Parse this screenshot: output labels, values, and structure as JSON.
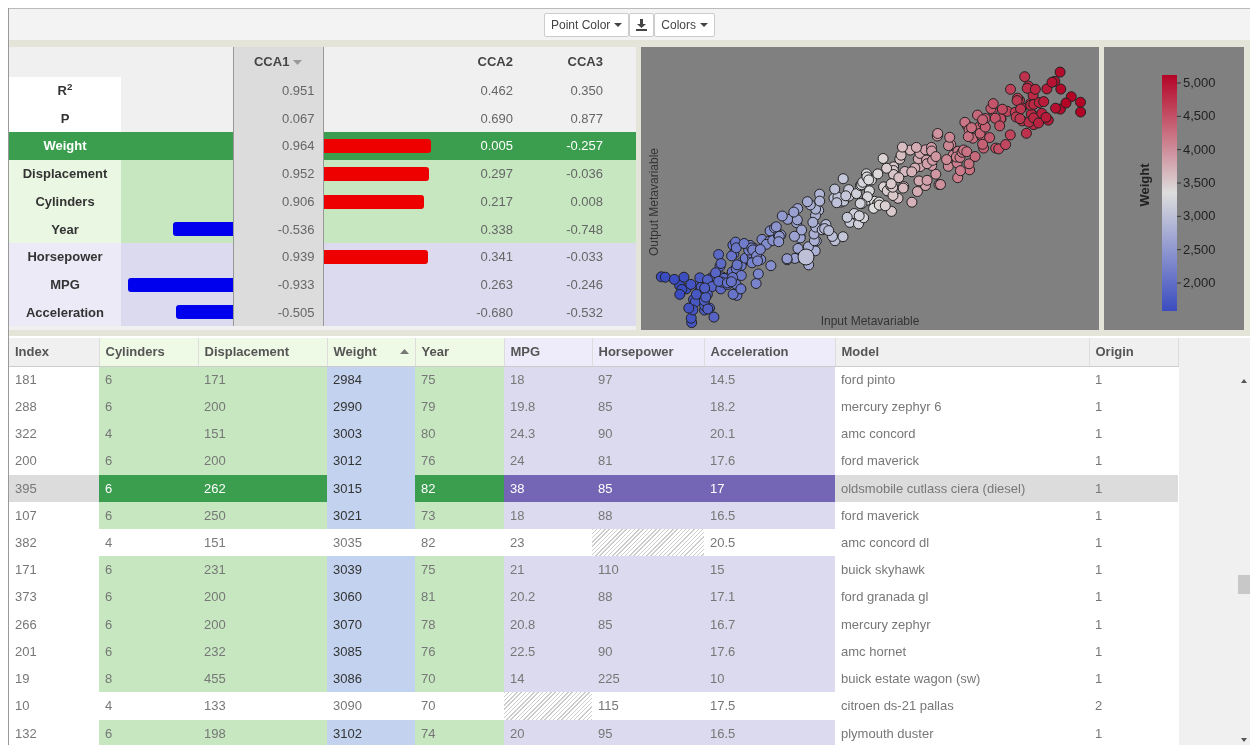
{
  "toolbar": {
    "buttons": [
      {
        "kind": "dropdown",
        "label": "Point Color"
      },
      {
        "kind": "download"
      },
      {
        "kind": "dropdown",
        "label": "Colors"
      }
    ]
  },
  "cca_table": {
    "columns": [
      {
        "label": "CCA1",
        "sorted": true
      },
      {
        "label": "CCA2",
        "sorted": false
      },
      {
        "label": "CCA3",
        "sorted": false
      }
    ],
    "stat_rows": [
      {
        "label": "R$^{2}$",
        "values": [
          "0.951",
          "0.462",
          "0.350"
        ]
      },
      {
        "label": "P",
        "values": [
          "0.067",
          "0.690",
          "0.877"
        ]
      }
    ],
    "variable_rows": [
      {
        "label": "Weight",
        "kind": "input",
        "selected": true,
        "bar": {
          "negative": false,
          "level": 0.98
        },
        "values": [
          "0.964",
          "0.005",
          "-0.257"
        ]
      },
      {
        "label": "Displacement",
        "kind": "input",
        "selected": false,
        "bar": {
          "negative": false,
          "level": 0.96
        },
        "values": [
          "0.952",
          "0.297",
          "-0.036"
        ]
      },
      {
        "label": "Cylinders",
        "kind": "input",
        "selected": false,
        "bar": {
          "negative": false,
          "level": 0.92
        },
        "values": [
          "0.906",
          "0.217",
          "0.008"
        ]
      },
      {
        "label": "Year",
        "kind": "input",
        "selected": false,
        "bar": {
          "negative": true,
          "level": 0.536
        },
        "values": [
          "-0.536",
          "0.338",
          "-0.748"
        ]
      },
      {
        "label": "Horsepower",
        "kind": "output",
        "selected": false,
        "bar": {
          "negative": false,
          "level": 0.95
        },
        "values": [
          "0.939",
          "0.341",
          "-0.033"
        ]
      },
      {
        "label": "MPG",
        "kind": "output",
        "selected": false,
        "bar": {
          "negative": true,
          "level": 0.933
        },
        "values": [
          "-0.933",
          "0.263",
          "-0.246"
        ]
      },
      {
        "label": "Acceleration",
        "kind": "output",
        "selected": false,
        "bar": {
          "negative": true,
          "level": 0.505
        },
        "values": [
          "-0.505",
          "-0.680",
          "-0.532"
        ]
      }
    ]
  },
  "scatter": {
    "xlabel": "Input Metavariable",
    "ylabel": "Output Metavariable"
  },
  "legend": {
    "title": "Weight",
    "ticks": [
      "5,000",
      "4,500",
      "4,000",
      "3,500",
      "3,000",
      "2,500",
      "2,000"
    ]
  },
  "table": {
    "columns": [
      {
        "label": "Index",
        "kind": "plain"
      },
      {
        "label": "Cylinders",
        "kind": "input"
      },
      {
        "label": "Displacement",
        "kind": "input"
      },
      {
        "label": "Weight",
        "kind": "input",
        "point_color": true,
        "sorted_ascending": true
      },
      {
        "label": "Year",
        "kind": "input"
      },
      {
        "label": "MPG",
        "kind": "output"
      },
      {
        "label": "Horsepower",
        "kind": "output"
      },
      {
        "label": "Acceleration",
        "kind": "output"
      },
      {
        "label": "Model",
        "kind": "plain"
      },
      {
        "label": "Origin",
        "kind": "plain"
      }
    ],
    "rows": [
      {
        "cells": [
          "181",
          "6",
          "171",
          "2984",
          "75",
          "18",
          "97",
          "14.5",
          "ford pinto",
          "1"
        ],
        "highlighted": true,
        "selected": false
      },
      {
        "cells": [
          "288",
          "6",
          "200",
          "2990",
          "79",
          "19.8",
          "85",
          "18.2",
          "mercury zephyr 6",
          "1"
        ],
        "highlighted": true,
        "selected": false
      },
      {
        "cells": [
          "322",
          "4",
          "151",
          "3003",
          "80",
          "24.3",
          "90",
          "20.1",
          "amc concord",
          "1"
        ],
        "highlighted": true,
        "selected": false
      },
      {
        "cells": [
          "200",
          "6",
          "200",
          "3012",
          "76",
          "24",
          "81",
          "17.6",
          "ford maverick",
          "1"
        ],
        "highlighted": true,
        "selected": false
      },
      {
        "cells": [
          "395",
          "6",
          "262",
          "3015",
          "82",
          "38",
          "85",
          "17",
          "oldsmobile cutlass ciera (diesel)",
          "1"
        ],
        "highlighted": true,
        "selected": true
      },
      {
        "cells": [
          "107",
          "6",
          "250",
          "3021",
          "73",
          "18",
          "88",
          "16.5",
          "ford maverick",
          "1"
        ],
        "highlighted": true,
        "selected": false
      },
      {
        "cells": [
          "382",
          "4",
          "151",
          "3035",
          "82",
          "23",
          null,
          "20.5",
          "amc concord dl",
          "1"
        ],
        "highlighted": false,
        "selected": false
      },
      {
        "cells": [
          "171",
          "6",
          "231",
          "3039",
          "75",
          "21",
          "110",
          "15",
          "buick skyhawk",
          "1"
        ],
        "highlighted": true,
        "selected": false
      },
      {
        "cells": [
          "373",
          "6",
          "200",
          "3060",
          "81",
          "20.2",
          "88",
          "17.1",
          "ford granada gl",
          "1"
        ],
        "highlighted": true,
        "selected": false
      },
      {
        "cells": [
          "266",
          "6",
          "200",
          "3070",
          "78",
          "20.8",
          "85",
          "16.7",
          "mercury zephyr",
          "1"
        ],
        "highlighted": true,
        "selected": false
      },
      {
        "cells": [
          "201",
          "6",
          "232",
          "3085",
          "76",
          "22.5",
          "90",
          "17.6",
          "amc hornet",
          "1"
        ],
        "highlighted": true,
        "selected": false
      },
      {
        "cells": [
          "19",
          "8",
          "455",
          "3086",
          "70",
          "14",
          "225",
          "10",
          "buick estate wagon (sw)",
          "1"
        ],
        "highlighted": true,
        "selected": false
      },
      {
        "cells": [
          "10",
          "4",
          "133",
          "3090",
          "70",
          null,
          "115",
          "17.5",
          "citroen ds-21 pallas",
          "2"
        ],
        "highlighted": false,
        "selected": false
      },
      {
        "cells": [
          "132",
          "6",
          "198",
          "3102",
          "74",
          "20",
          "95",
          "16.5",
          "plymouth duster",
          "1"
        ],
        "highlighted": true,
        "selected": false
      }
    ]
  }
}
